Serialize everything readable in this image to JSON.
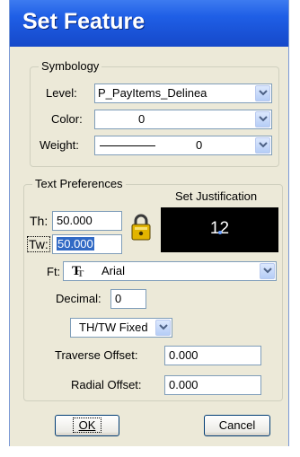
{
  "window": {
    "title": "Set Feature"
  },
  "symbology": {
    "legend": "Symbology",
    "level_label": "Level:",
    "level_value": "P_PayItems_Delinea",
    "color_label": "Color:",
    "color_value": "0",
    "weight_label": "Weight:",
    "weight_value": "0"
  },
  "text_preferences": {
    "legend": "Text Preferences",
    "th_label": "Th:",
    "th_value": "50.000",
    "tw_label": "Tw:",
    "tw_value": "50.000",
    "lock_icon": "lock-icon",
    "set_justification_label": "Set Justification",
    "justification_value": "12",
    "ft_label": "Ft:",
    "font_icon": "truetype-font-icon",
    "font_value": "Arial",
    "decimal_label": "Decimal:",
    "decimal_value": "0",
    "mode_value": "TH/TW Fixed",
    "traverse_offset_label": "Traverse Offset:",
    "traverse_offset_value": "0.000",
    "radial_offset_label": "Radial Offset:",
    "radial_offset_value": "0.000"
  },
  "buttons": {
    "ok": "OK",
    "cancel": "Cancel"
  },
  "colors": {
    "title_bar": "#1f5fe6",
    "dialog_bg": "#ece9d8",
    "selection": "#316ac5"
  }
}
